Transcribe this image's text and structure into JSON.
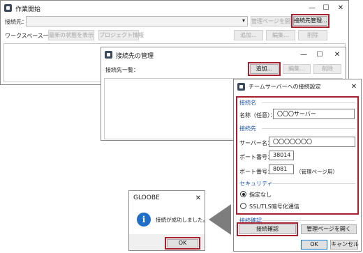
{
  "main_window": {
    "title": "作業開始",
    "connection_label": "接続先：",
    "connection_value": "",
    "manager_page_button": "管理ページを開く",
    "connection_manage_button": "接続先管理...",
    "workspace_label": "ワークスペース一覧：",
    "show_latest_button": "最新の状態を表示",
    "project_info_button": "プロジェクト情報",
    "add_button": "追加...",
    "edit_button": "編集...",
    "delete_button": "削除"
  },
  "manage_window": {
    "title": "接続先の管理",
    "list_label": "接続先一覧：",
    "add_button": "追加...",
    "edit_button": "編集...",
    "delete_button": "削除"
  },
  "settings_window": {
    "title": "チームサーバーへの接続設定",
    "name_section": "接続名",
    "name_label": "名称（任意）：",
    "name_value": "〇〇〇サーバー",
    "connection_section": "接続先",
    "server_label": "サーバー名：",
    "server_value": "〇〇〇〇〇〇〇",
    "port_label": "ポート番号：",
    "port_value": "38014",
    "admin_port_label": "ポート番号：",
    "admin_port_value": "8081",
    "admin_port_note": "（管理ページ用）",
    "security_section": "セキュリティ",
    "security_option_none": "指定なし",
    "security_option_ssl": "SSL/TLS暗号化通信",
    "check_section": "接続確認",
    "check_button": "接続確認",
    "open_admin_button": "管理ページを開く",
    "ok_button": "OK",
    "cancel_button": "キャンセル"
  },
  "message_box": {
    "title": "GLOOBE",
    "message": "接続が成功しました。",
    "ok_button": "OK"
  },
  "window_controls": {
    "minimize": "—",
    "maximize": "☐",
    "close": "✕",
    "dropdown_arrow": "▾",
    "info_glyph": "i"
  },
  "colors": {
    "highlight_border": "#a8202e",
    "section_heading": "#2456a6",
    "info_icon": "#1f6fc9",
    "arrow": "#7d7d7d"
  }
}
